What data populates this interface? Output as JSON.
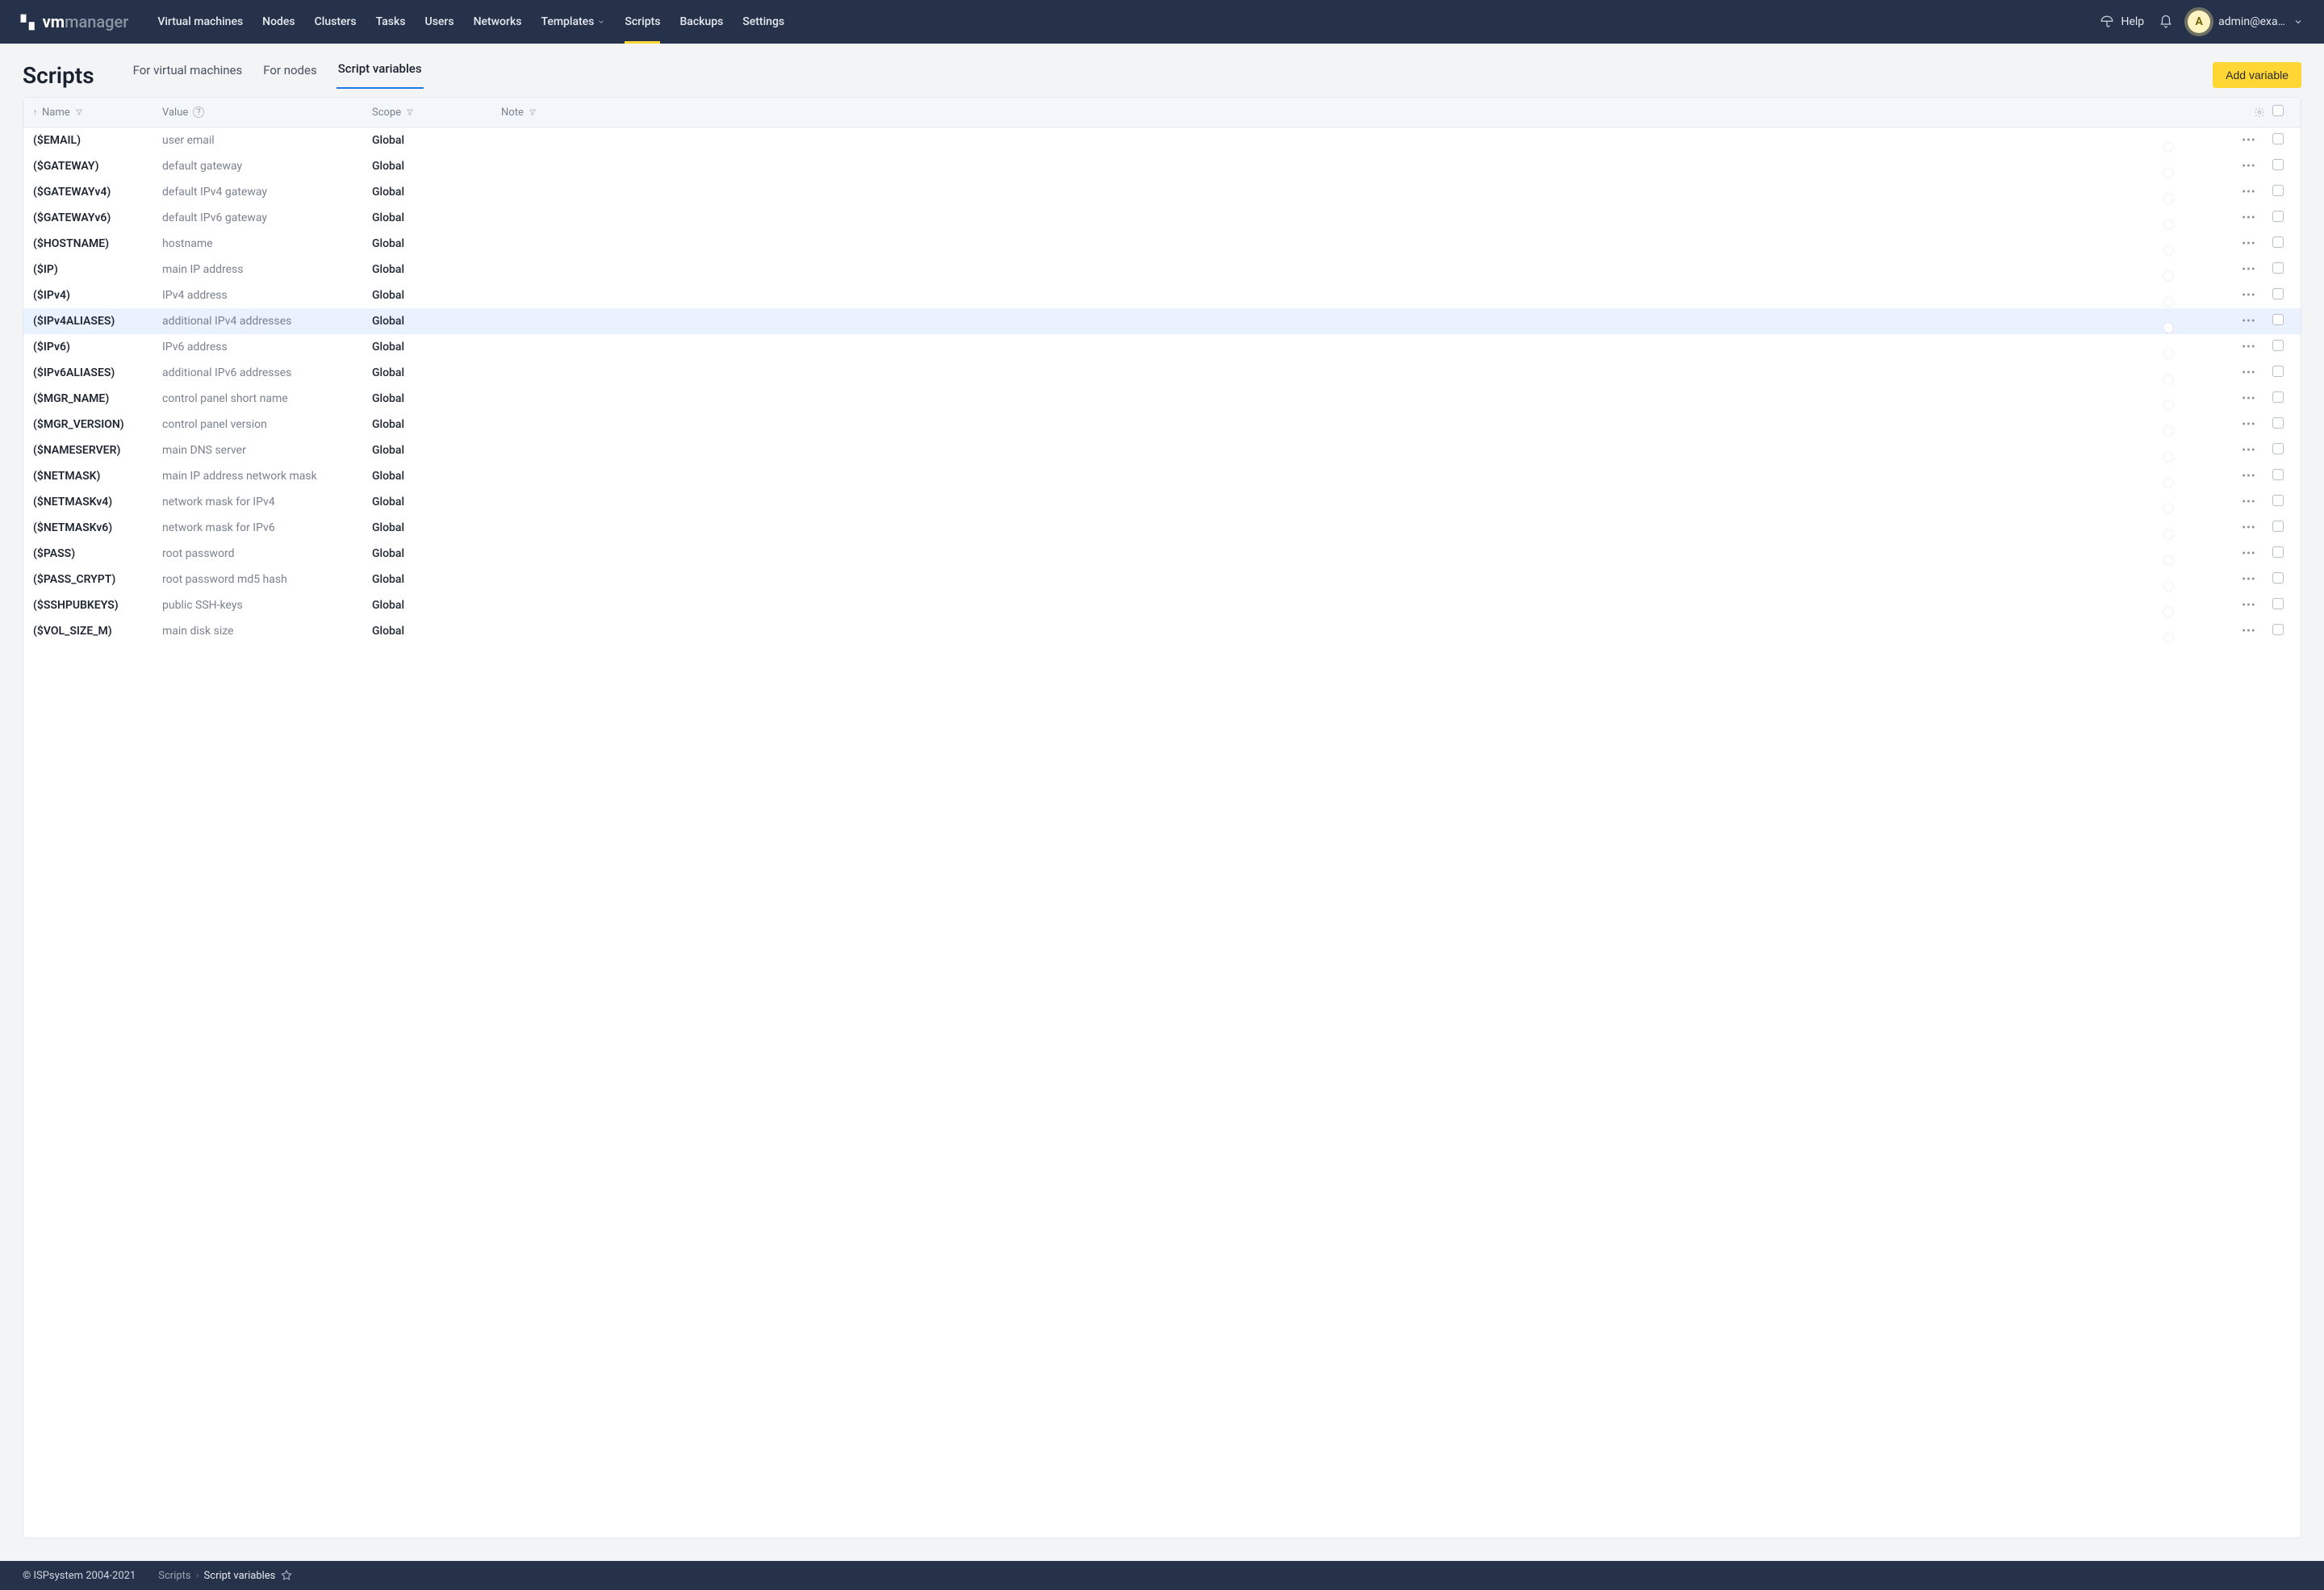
{
  "app": {
    "logo_vm": "vm",
    "logo_rest": "manager"
  },
  "nav": {
    "items": [
      {
        "label": "Virtual machines"
      },
      {
        "label": "Nodes"
      },
      {
        "label": "Clusters"
      },
      {
        "label": "Tasks"
      },
      {
        "label": "Users"
      },
      {
        "label": "Networks"
      },
      {
        "label": "Templates",
        "has_chevron": true
      },
      {
        "label": "Scripts",
        "active": true
      },
      {
        "label": "Backups"
      },
      {
        "label": "Settings"
      }
    ],
    "help_label": "Help"
  },
  "user": {
    "initial": "A",
    "email": "admin@exa…"
  },
  "page": {
    "title": "Scripts",
    "subtabs": [
      {
        "label": "For virtual machines"
      },
      {
        "label": "For nodes"
      },
      {
        "label": "Script variables",
        "active": true
      }
    ],
    "add_button": "Add variable"
  },
  "columns": {
    "name": "Name",
    "value": "Value",
    "scope": "Scope",
    "note": "Note"
  },
  "scope_global": "Global",
  "rows": [
    {
      "name": "($EMAIL)",
      "value": "user email"
    },
    {
      "name": "($GATEWAY)",
      "value": "default gateway"
    },
    {
      "name": "($GATEWAYv4)",
      "value": "default IPv4 gateway"
    },
    {
      "name": "($GATEWAYv6)",
      "value": "default IPv6 gateway"
    },
    {
      "name": "($HOSTNAME)",
      "value": "hostname"
    },
    {
      "name": "($IP)",
      "value": "main IP address"
    },
    {
      "name": "($IPv4)",
      "value": "IPv4 address"
    },
    {
      "name": "($IPv4ALIASES)",
      "value": "additional IPv4 addresses",
      "highlight": true
    },
    {
      "name": "($IPv6)",
      "value": "IPv6 address"
    },
    {
      "name": "($IPv6ALIASES)",
      "value": "additional IPv6 addresses"
    },
    {
      "name": "($MGR_NAME)",
      "value": "control panel short name"
    },
    {
      "name": "($MGR_VERSION)",
      "value": "control panel version"
    },
    {
      "name": "($NAMESERVER)",
      "value": "main DNS server"
    },
    {
      "name": "($NETMASK)",
      "value": "main IP address network mask"
    },
    {
      "name": "($NETMASKv4)",
      "value": "network mask for IPv4"
    },
    {
      "name": "($NETMASKv6)",
      "value": "network mask for IPv6"
    },
    {
      "name": "($PASS)",
      "value": "root password"
    },
    {
      "name": "($PASS_CRYPT)",
      "value": "root password md5 hash"
    },
    {
      "name": "($SSHPUBKEYS)",
      "value": "public SSH-keys"
    },
    {
      "name": "($VOL_SIZE_M)",
      "value": "main disk size"
    }
  ],
  "footer": {
    "copyright": "© ISPsystem 2004-2021",
    "breadcrumb_root": "Scripts",
    "breadcrumb_current": "Script variables"
  }
}
